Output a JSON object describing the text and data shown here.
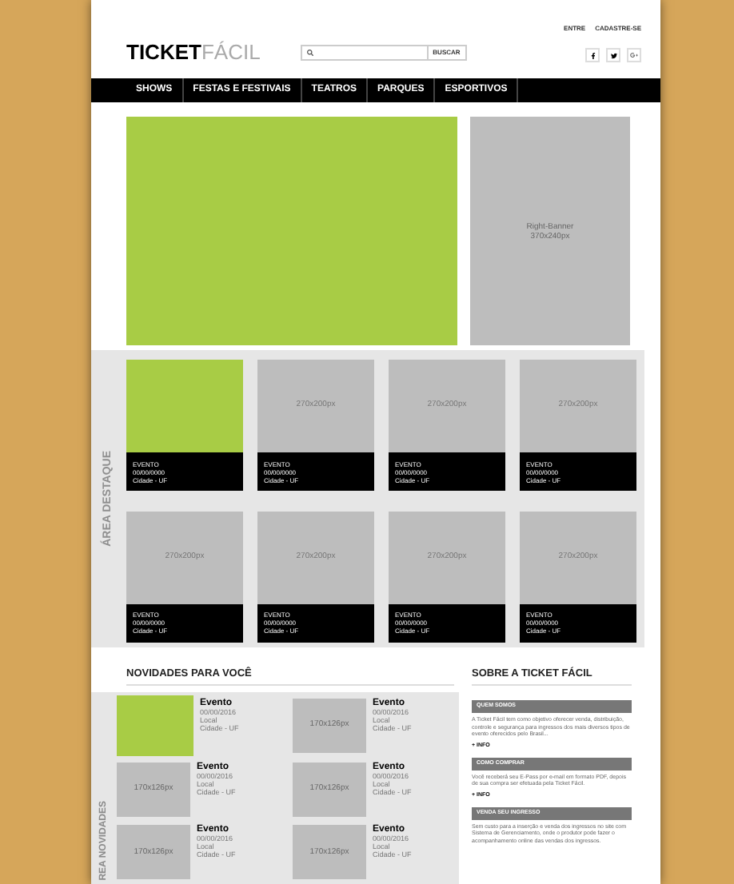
{
  "header": {
    "logo": {
      "dark": "TICKET",
      "light": "FÁCIL"
    },
    "search": {
      "button": "BUSCAR"
    },
    "top_links": [
      "ENTRE",
      "CADASTRE-SE"
    ]
  },
  "nav": {
    "items": [
      {
        "label": "SHOWS"
      },
      {
        "label": "FESTAS E FESTIVAIS"
      },
      {
        "label": "TEATROS"
      },
      {
        "label": "PARQUES"
      },
      {
        "label": "ESPORTIVOS"
      }
    ]
  },
  "right_banner": {
    "lines": [
      "Right-Banner",
      "370x240px"
    ]
  },
  "featured": {
    "label": "ÁREA DESTAQUE",
    "cards": [
      {
        "kind": "highlight",
        "title": "EVENTO",
        "date": "00/00/0000",
        "city": "Cidade - UF"
      },
      {
        "kind": "placeholder",
        "size": "270x200px",
        "title": "EVENTO",
        "date": "00/00/0000",
        "city": "Cidade - UF"
      },
      {
        "kind": "placeholder",
        "size": "270x200px",
        "title": "EVENTO",
        "date": "00/00/0000",
        "city": "Cidade - UF"
      },
      {
        "kind": "placeholder",
        "size": "270x200px",
        "title": "EVENTO",
        "date": "00/00/0000",
        "city": "Cidade - UF"
      },
      {
        "kind": "placeholder",
        "size": "270x200px",
        "title": "EVENTO",
        "date": "00/00/0000",
        "city": "Cidade - UF"
      },
      {
        "kind": "placeholder",
        "size": "270x200px",
        "title": "EVENTO",
        "date": "00/00/0000",
        "city": "Cidade - UF"
      },
      {
        "kind": "placeholder",
        "size": "270x200px",
        "title": "EVENTO",
        "date": "00/00/0000",
        "city": "Cidade - UF"
      },
      {
        "kind": "placeholder",
        "size": "270x200px",
        "title": "EVENTO",
        "date": "00/00/0000",
        "city": "Cidade - UF"
      }
    ]
  },
  "news": {
    "title": "NOVIDADES PARA VOCÊ",
    "label": "REA NOVIDADES",
    "items": [
      {
        "kind": "highlight",
        "title": "Evento",
        "date": "00/00/2016",
        "place": "Local",
        "city": "Cidade - UF"
      },
      {
        "kind": "placeholder",
        "size": "170x126px",
        "title": "Evento",
        "date": "00/00/2016",
        "place": "Local",
        "city": "Cidade - UF"
      },
      {
        "kind": "placeholder",
        "size": "170x126px",
        "title": "Evento",
        "date": "00/00/2016",
        "place": "Local",
        "city": "Cidade - UF"
      },
      {
        "kind": "placeholder",
        "size": "170x126px",
        "title": "Evento",
        "date": "00/00/2016",
        "place": "Local",
        "city": "Cidade - UF"
      },
      {
        "kind": "placeholder",
        "size": "170x126px",
        "title": "Evento",
        "date": "00/00/2016",
        "place": "Local",
        "city": "Cidade - UF"
      },
      {
        "kind": "placeholder",
        "size": "170x126px",
        "title": "Evento",
        "date": "00/00/2016",
        "place": "Local",
        "city": "Cidade - UF"
      }
    ]
  },
  "about": {
    "title": "SOBRE A TICKET FÁCIL",
    "sections": [
      {
        "heading": "QUEM SOMOS",
        "text": "A Ticket Fácil tem como objetivo oferecer venda, distribuição, controle e segurança para ingressos dos mais diversos tipos de evento oferecidos pelo Brasil...",
        "link": "+ INFO"
      },
      {
        "heading": "COMO COMPRAR",
        "text": "Você receberá seu E-Pass por e-mail em formato PDF, depois de sua compra ser efetuada pela Ticket Fácil.",
        "link": "+ INFO"
      },
      {
        "heading": "VENDA SEU INGRESSO",
        "text": "Sem custo para a inserção e venda dos ingressos no site com Sistema de Gerenciamento, onde o produtor pode fazer o acompanhamento online das vendas dos ingressos."
      }
    ]
  }
}
